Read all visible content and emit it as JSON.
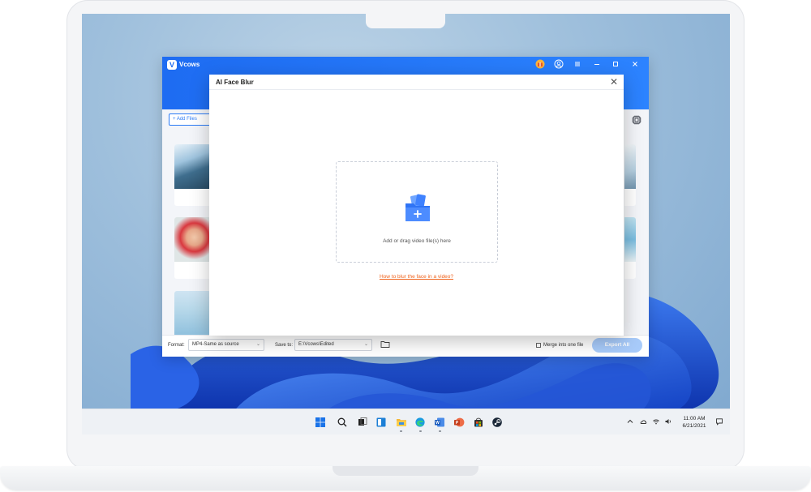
{
  "app": {
    "title": "Vcows",
    "logo_glyph": "V",
    "header_icons": [
      "gift-icon",
      "user-icon",
      "menu-icon",
      "minimize-icon",
      "maximize-icon",
      "close-icon"
    ],
    "add_files_label": "+ Add Files",
    "accent_color": "#1e6cf2"
  },
  "dialog": {
    "title": "AI Face Blur",
    "close_glyph": "✕",
    "drop_text": "Add or drag video file(s) here",
    "help_link": "How to blur the face in a video?"
  },
  "footer": {
    "format_label": "Format:",
    "format_value": "MP4-Same as source",
    "save_label": "Save to:",
    "save_value": "E:\\Vcows\\Edited",
    "merge_label": "Merge into one file",
    "merge_checked": false,
    "export_label": "Export All"
  },
  "taskbar": {
    "time": "11:00 AM",
    "date": "6/21/2021",
    "apps": [
      "windows-start-icon",
      "search-icon",
      "task-view-icon",
      "widgets-icon",
      "file-explorer-icon",
      "edge-icon",
      "word-icon",
      "powerpoint-icon",
      "store-icon",
      "steam-icon"
    ],
    "tray": [
      "chevron-up-icon",
      "cloud-icon",
      "wifi-icon",
      "speaker-icon",
      "notification-icon"
    ]
  }
}
